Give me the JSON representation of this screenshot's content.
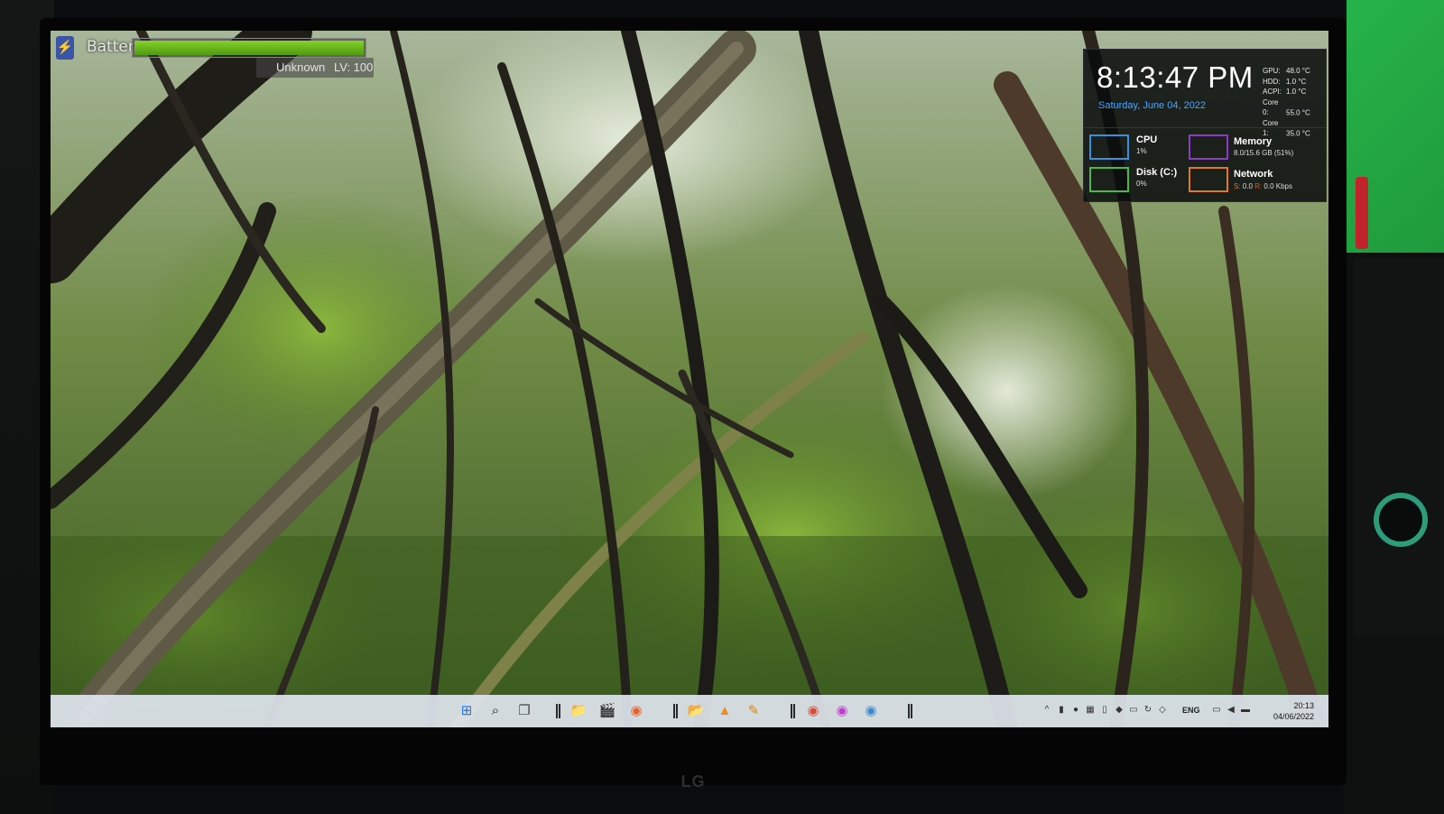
{
  "battery": {
    "label": "Battery",
    "level": 1.0,
    "status": "Unknown",
    "level_text": "LV: 100",
    "bolt_glyph": "⚡"
  },
  "clock": {
    "time": "8:13:47 PM",
    "date": "Saturday, June 04, 2022"
  },
  "temps": [
    {
      "name": "GPU:",
      "value": "48.0 °C"
    },
    {
      "name": "HDD:",
      "value": "1.0 °C"
    },
    {
      "name": "ACPI:",
      "value": "1.0 °C"
    },
    {
      "name": "Core 0:",
      "value": "55.0 °C"
    },
    {
      "name": "Core 1:",
      "value": "35.0 °C"
    }
  ],
  "metrics": {
    "cpu": {
      "title": "CPU",
      "value": "1%",
      "color": "#3b8fe0"
    },
    "memory": {
      "title": "Memory",
      "value": "8.0/15.6 GB (51%)",
      "color": "#8a3cc8"
    },
    "disk": {
      "title": "Disk (C:)",
      "value": "0%",
      "color": "#4bb84b"
    },
    "network": {
      "title": "Network",
      "value_s_label": "S:",
      "value_s": "0.0",
      "value_r_label": "R:",
      "value_r": "0.0 Kbps",
      "color": "#e07a2a"
    }
  },
  "taskbar": {
    "apps": [
      {
        "name": "start-icon",
        "glyph": "⊞",
        "color": "#1a73e8"
      },
      {
        "name": "search-icon",
        "glyph": "⌕",
        "color": "#222"
      },
      {
        "name": "task-view-icon",
        "glyph": "❐",
        "color": "#444"
      },
      {
        "name": "file-explorer-icon",
        "glyph": "📁",
        "color": "#e8b32a"
      },
      {
        "name": "media-player-icon",
        "glyph": "🎬",
        "color": "#333"
      },
      {
        "name": "firefox-icon",
        "glyph": "◉",
        "color": "#e8622a"
      },
      {
        "name": "folder-icon",
        "glyph": "📂",
        "color": "#3a7be0"
      },
      {
        "name": "vlc-icon",
        "glyph": "▲",
        "color": "#f08a1a"
      },
      {
        "name": "pen-tool-icon",
        "glyph": "✎",
        "color": "#d08a1a"
      },
      {
        "name": "chrome-icon",
        "glyph": "◉",
        "color": "#dd4b3a"
      },
      {
        "name": "chrome-profile-2-icon",
        "glyph": "◉",
        "color": "#c43ad0"
      },
      {
        "name": "chrome-profile-3-icon",
        "glyph": "◉",
        "color": "#3a8ad0"
      }
    ],
    "language": "ENG",
    "time": "20:13",
    "date": "04/06/2022"
  },
  "monitor_brand": "LG"
}
